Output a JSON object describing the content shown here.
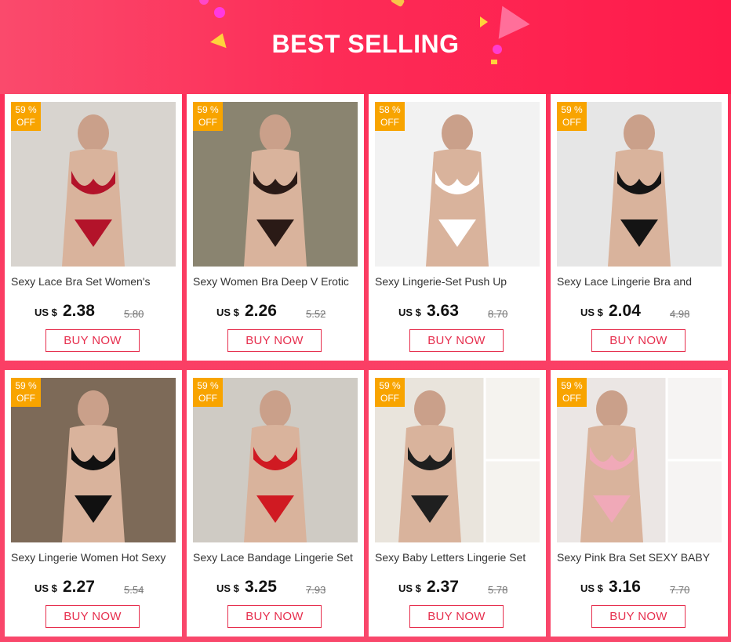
{
  "header": {
    "title": "BEST SELLING"
  },
  "products": [
    {
      "name": "Sexy Lace Bra Set Women's",
      "discount_value": "59",
      "discount_unit": "%",
      "discount_label": "OFF",
      "currency": "US $",
      "price": "2.38",
      "old_price": "5.80",
      "buy_label": "BUY NOW",
      "image": "red-lace-lingerie-photo",
      "colors": {
        "bg": "#d8d4cf",
        "item": "#b3132a"
      }
    },
    {
      "name": "Sexy Women Bra Deep V Erotic",
      "discount_value": "59",
      "discount_unit": "%",
      "discount_label": "OFF",
      "currency": "US $",
      "price": "2.26",
      "old_price": "5.52",
      "buy_label": "BUY NOW",
      "image": "black-lace-bodysuit-photo",
      "colors": {
        "bg": "#8a8470",
        "item": "#2a1a16"
      }
    },
    {
      "name": "Sexy Lingerie-Set Push Up",
      "discount_value": "58",
      "discount_unit": "%",
      "discount_label": "OFF",
      "currency": "US $",
      "price": "3.63",
      "old_price": "8.70",
      "buy_label": "BUY NOW",
      "image": "white-lace-set-photo",
      "colors": {
        "bg": "#f2f2f2",
        "item": "#ffffff"
      }
    },
    {
      "name": "Sexy Lace Lingerie Bra and",
      "discount_value": "59",
      "discount_unit": "%",
      "discount_label": "OFF",
      "currency": "US $",
      "price": "2.04",
      "old_price": "4.98",
      "buy_label": "BUY NOW",
      "image": "black-strappy-set-photo",
      "colors": {
        "bg": "#e6e6e6",
        "item": "#141414"
      }
    },
    {
      "name": "Sexy Lingerie Women Hot Sexy",
      "discount_value": "59",
      "discount_unit": "%",
      "discount_label": "OFF",
      "currency": "US $",
      "price": "2.27",
      "old_price": "5.54",
      "buy_label": "BUY NOW",
      "image": "black-fishnet-body-photo",
      "colors": {
        "bg": "#7d6a58",
        "item": "#111111"
      }
    },
    {
      "name": "Sexy Lace Bandage Lingerie Set",
      "discount_value": "59",
      "discount_unit": "%",
      "discount_label": "OFF",
      "currency": "US $",
      "price": "3.25",
      "old_price": "7.93",
      "buy_label": "BUY NOW",
      "image": "red-garter-set-photo",
      "colors": {
        "bg": "#cfcbc4",
        "item": "#d01a22"
      }
    },
    {
      "name": "Sexy Baby Letters Lingerie Set",
      "discount_value": "59",
      "discount_unit": "%",
      "discount_label": "OFF",
      "currency": "US $",
      "price": "2.37",
      "old_price": "5.78",
      "buy_label": "BUY NOW",
      "image": "baby-letters-set-collage",
      "colors": {
        "bg": "#e9e4dc",
        "item": "#1f1f1f"
      }
    },
    {
      "name": "Sexy Pink Bra Set SEXY BABY",
      "discount_value": "59",
      "discount_unit": "%",
      "discount_label": "OFF",
      "currency": "US $",
      "price": "3.16",
      "old_price": "7.70",
      "buy_label": "BUY NOW",
      "image": "pink-lace-set-collage",
      "colors": {
        "bg": "#ebe6e4",
        "item": "#f0a9b8"
      }
    }
  ]
}
